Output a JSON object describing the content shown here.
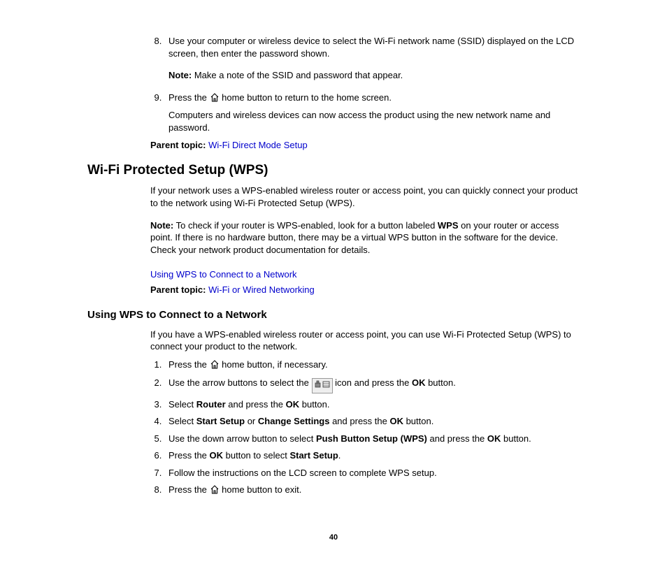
{
  "top_list": {
    "item8_text": "Use your computer or wireless device to select the Wi-Fi network name (SSID) displayed on the LCD screen, then enter the password shown.",
    "item8_note_label": "Note:",
    "item8_note_text": " Make a note of the SSID and password that appear.",
    "item9_pre": "Press the ",
    "item9_post": " home button to return to the home screen.",
    "item9_body": "Computers and wireless devices can now access the product using the new network name and password."
  },
  "parent1_label": "Parent topic: ",
  "parent1_link": "Wi-Fi Direct Mode Setup",
  "wps": {
    "heading": "Wi-Fi Protected Setup (WPS)",
    "intro": "If your network uses a WPS-enabled wireless router or access point, you can quickly connect your product to the network using Wi-Fi Protected Setup (WPS).",
    "note_label": "Note:",
    "note_pre": " To check if your router is WPS-enabled, look for a button labeled ",
    "note_bold": "WPS",
    "note_post": " on your router or access point. If there is no hardware button, there may be a virtual WPS button in the software for the device. Check your network product documentation for details.",
    "link1": "Using WPS to Connect to a Network",
    "parent_label": "Parent topic: ",
    "parent_link": "Wi-Fi or Wired Networking"
  },
  "using": {
    "heading": "Using WPS to Connect to a Network",
    "intro": "If you have a WPS-enabled wireless router or access point, you can use Wi-Fi Protected Setup (WPS) to connect your product to the network.",
    "s1_pre": "Press the ",
    "s1_post": " home button, if necessary.",
    "s2_pre": "Use the arrow buttons to select the ",
    "s2_mid": " icon and press the ",
    "s2_ok": "OK",
    "s2_post": " button.",
    "s3_pre": "Select ",
    "s3_b1": "Router",
    "s3_mid": " and press the ",
    "s3_ok": "OK",
    "s3_post": " button.",
    "s4_pre": "Select ",
    "s4_b1": "Start Setup",
    "s4_or": " or ",
    "s4_b2": "Change Settings",
    "s4_mid": " and press the ",
    "s4_ok": "OK",
    "s4_post": " button.",
    "s5_pre": "Use the down arrow button to select ",
    "s5_b1": "Push Button Setup (WPS)",
    "s5_mid": " and press the ",
    "s5_ok": "OK",
    "s5_post": " button.",
    "s6_pre": "Press the ",
    "s6_ok": "OK",
    "s6_mid": " button to select ",
    "s6_b1": "Start Setup",
    "s6_post": ".",
    "s7": "Follow the instructions on the LCD screen to complete WPS setup.",
    "s8_pre": "Press the ",
    "s8_post": " home button to exit."
  },
  "page_number": "40"
}
